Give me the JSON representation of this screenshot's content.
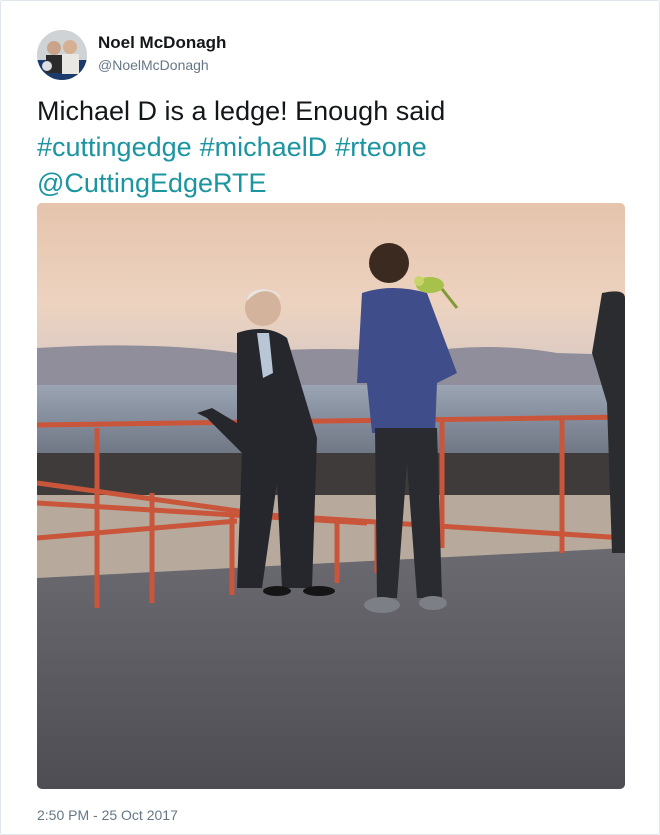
{
  "author": {
    "name": "Noel McDonagh",
    "handle": "@NoelMcDonagh"
  },
  "tweet": {
    "text": "Michael D is a ledge! Enough said",
    "hashtags": [
      "#cuttingedge",
      "#michaelD",
      "#rteone"
    ],
    "mention": "@CuttingEdgeRTE"
  },
  "photo": {
    "description_icon": "photo-image"
  },
  "timestamp": "2:50 PM - 25 Oct 2017",
  "colors": {
    "link": "#1b95a0",
    "text": "#14171a",
    "secondary": "#657786",
    "border": "#e1e8ed"
  }
}
